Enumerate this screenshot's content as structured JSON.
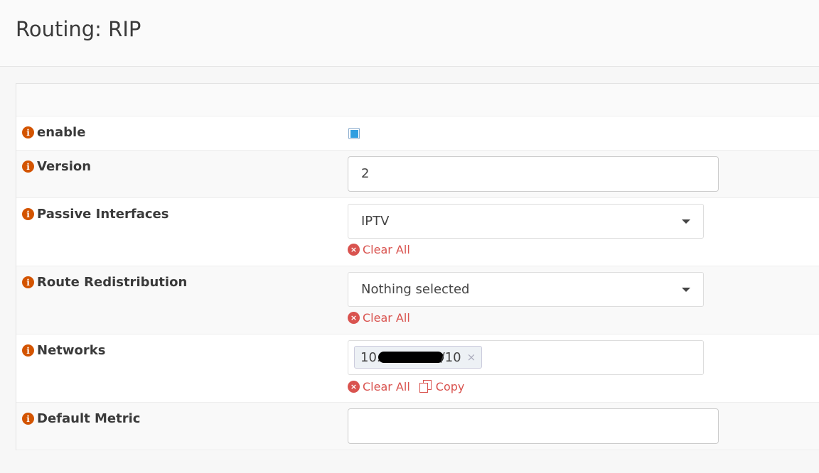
{
  "header": {
    "title": "Routing: RIP"
  },
  "fields": {
    "enable": {
      "label": "enable",
      "checked": true
    },
    "version": {
      "label": "Version",
      "value": "2"
    },
    "passive": {
      "label": "Passive Interfaces",
      "value": "IPTV",
      "clear": "Clear All"
    },
    "redistribution": {
      "label": "Route Redistribution",
      "value": "Nothing selected",
      "clear": "Clear All"
    },
    "networks": {
      "label": "Networks",
      "tag_prefix": "10.",
      "tag_suffix": "/10",
      "tag_remove": "×",
      "clear": "Clear All",
      "copy": "Copy"
    },
    "metric": {
      "label": "Default Metric",
      "value": ""
    }
  },
  "icons": {
    "info": "i",
    "clear": "×"
  },
  "colors": {
    "info": "#d35400",
    "danger": "#d9534f",
    "checkbox": "#2f9ee0"
  }
}
